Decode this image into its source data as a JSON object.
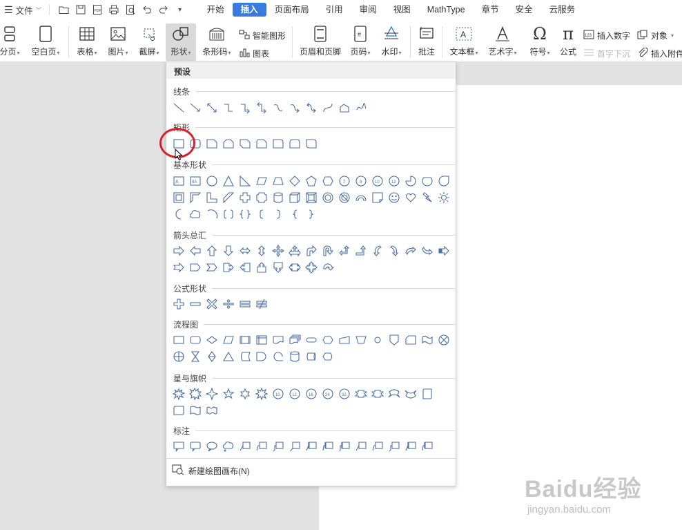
{
  "menubar": {
    "menu_icon": "hamburger-icon",
    "file_label": "文件",
    "quick_access": [
      "open-folder-icon",
      "save-icon",
      "pdf-icon",
      "print-icon",
      "preview-icon",
      "undo-icon",
      "redo-icon",
      "customize-icon"
    ],
    "tabs": [
      "开始",
      "插入",
      "页面布局",
      "引用",
      "审阅",
      "视图",
      "MathType",
      "章节",
      "安全",
      "云服务"
    ],
    "active_tab": "插入"
  },
  "ribbon": {
    "page_break": "分页",
    "blank_page": "空白页",
    "table": "表格",
    "picture": "图片",
    "screenshot": "截屏",
    "shape": "形状",
    "barcode": "条形码",
    "smart_art": "智能图形",
    "chart": "图表",
    "header_footer": "页眉和页脚",
    "page_number": "页码",
    "watermark": "水印",
    "comment": "批注",
    "textbox": "文本框",
    "wordart": "艺术字",
    "symbol": "符号",
    "formula": "公式",
    "insert_number": "插入数字",
    "object": "对象",
    "drop_cap": "首字下沉",
    "attachment": "插入附件"
  },
  "panel": {
    "title": "预设",
    "sections": {
      "lines": "线条",
      "rectangles": "矩形",
      "basic": "基本形状",
      "arrows": "箭头总汇",
      "equation": "公式形状",
      "flowchart": "流程图",
      "stars": "星与旗帜",
      "callouts": "标注"
    },
    "new_canvas": "新建绘图画布(N)"
  },
  "watermark": {
    "brand": "Baidu经验",
    "url": "jingyan.baidu.com"
  },
  "colors": {
    "accent": "#3a7be0",
    "shape_stroke": "#4a6fa5",
    "highlight": "#d9202a"
  }
}
